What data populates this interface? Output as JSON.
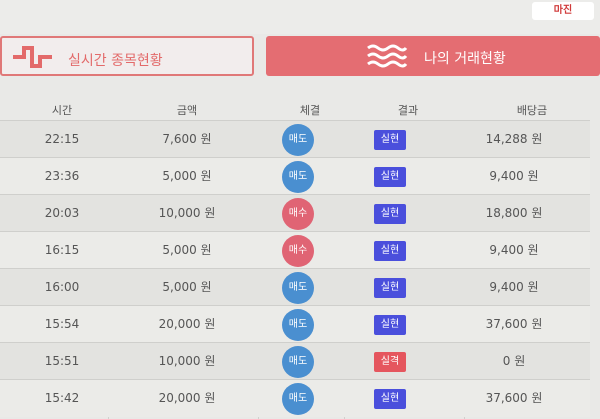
{
  "logo": {
    "text": "마진"
  },
  "tabs": [
    {
      "label": "실시간 종목현황",
      "icon": "pulse-icon",
      "active": false
    },
    {
      "label": "나의 거래현황",
      "icon": "wave-icon",
      "active": true
    }
  ],
  "columns": [
    "시간",
    "금액",
    "체결",
    "결과",
    "배당금"
  ],
  "colors": {
    "sell": "#4a8fd0",
    "buy": "#e06474",
    "win": "#4a4fdc",
    "lose": "#e5565e",
    "accent": "#e46d72"
  },
  "rows": [
    {
      "time": "22:15",
      "amount": "7,600 원",
      "trade": "매도",
      "result": "실현",
      "payout": "14,288 원"
    },
    {
      "time": "23:36",
      "amount": "5,000 원",
      "trade": "매도",
      "result": "실현",
      "payout": "9,400 원"
    },
    {
      "time": "20:03",
      "amount": "10,000 원",
      "trade": "매수",
      "result": "실현",
      "payout": "18,800 원"
    },
    {
      "time": "16:15",
      "amount": "5,000 원",
      "trade": "매수",
      "result": "실현",
      "payout": "9,400 원"
    },
    {
      "time": "16:00",
      "amount": "5,000 원",
      "trade": "매도",
      "result": "실현",
      "payout": "9,400 원"
    },
    {
      "time": "15:54",
      "amount": "20,000 원",
      "trade": "매도",
      "result": "실현",
      "payout": "37,600 원"
    },
    {
      "time": "15:51",
      "amount": "10,000 원",
      "trade": "매도",
      "result": "실격",
      "payout": "0 원"
    },
    {
      "time": "15:42",
      "amount": "20,000 원",
      "trade": "매도",
      "result": "실현",
      "payout": "37,600 원"
    }
  ]
}
